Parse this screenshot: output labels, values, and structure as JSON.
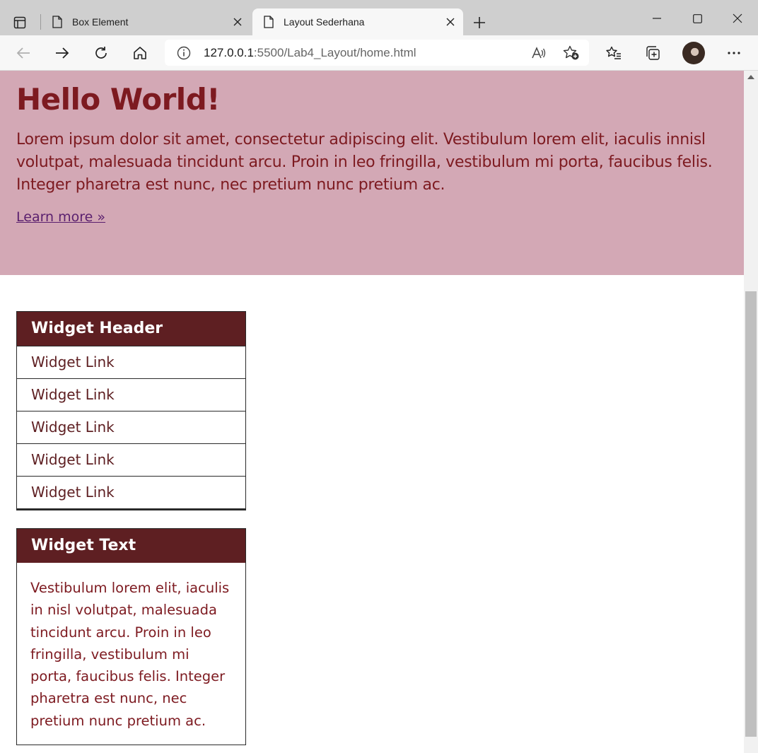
{
  "browser": {
    "tabs": [
      {
        "title": "Box Element",
        "active": false
      },
      {
        "title": "Layout Sederhana",
        "active": true
      }
    ],
    "address": {
      "host": "127.0.0.1",
      "path": ":5500/Lab4_Layout/home.html"
    }
  },
  "page": {
    "hero": {
      "title": "Hello World!",
      "paragraph": "Lorem ipsum dolor sit amet, consectetur adipiscing elit. Vestibulum lorem elit, iaculis innisl volutpat, malesuada tincidunt arcu. Proin in leo fringilla, vestibulum mi porta, faucibus felis. Integer pharetra est nunc, nec pretium nunc pretium ac.",
      "link": "Learn more »",
      "background": "#d3a8b5",
      "text_color": "#7d1a20"
    },
    "widget_links": {
      "header": "Widget Header",
      "items": [
        "Widget Link",
        "Widget Link",
        "Widget Link",
        "Widget Link",
        "Widget Link"
      ]
    },
    "widget_text": {
      "header": "Widget Text",
      "body": "Vestibulum lorem elit, iaculis in nisl volutpat, malesuada tincidunt arcu. Proin in leo fringilla, vestibulum mi porta, faucibus felis. Integer pharetra est nunc, nec pretium nunc pretium ac."
    },
    "accent_color": "#5e1f22"
  }
}
